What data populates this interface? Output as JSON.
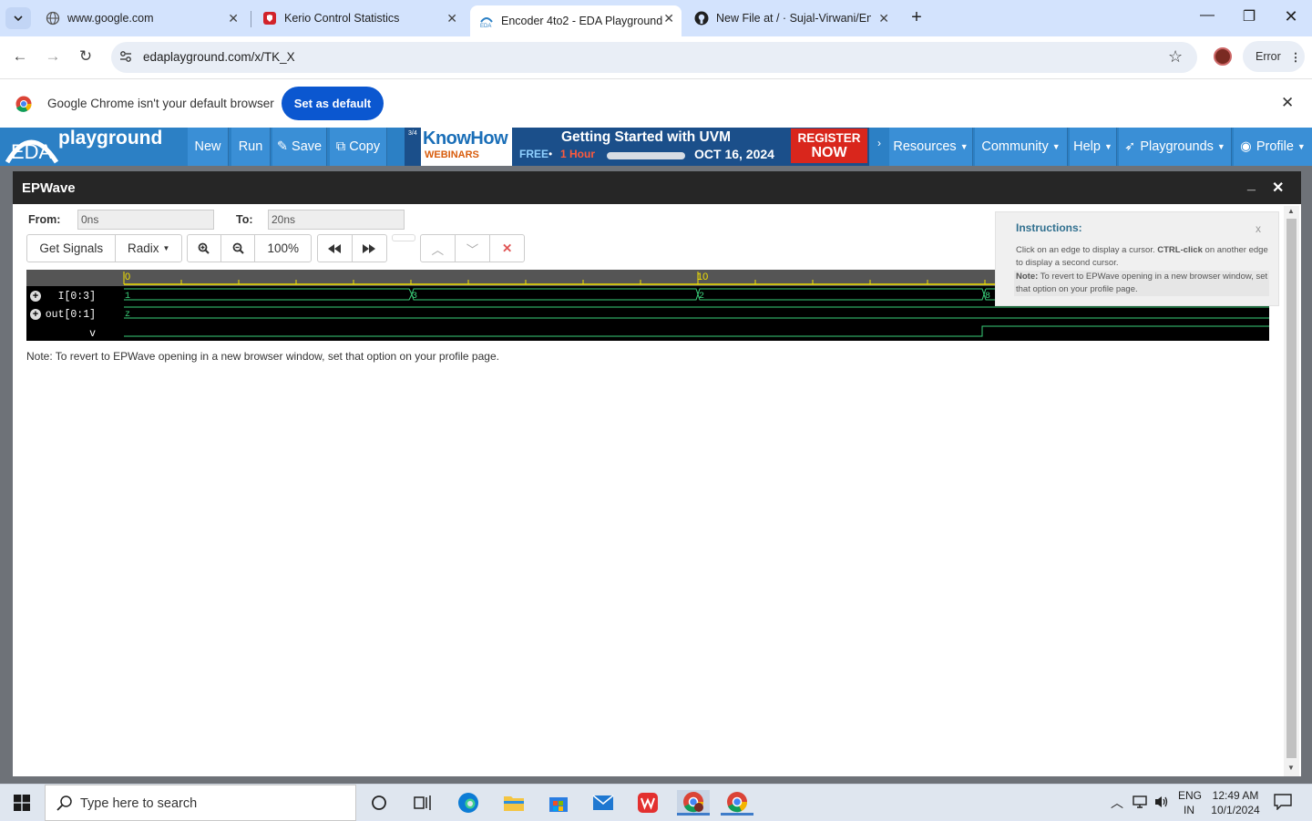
{
  "browser": {
    "tabs": [
      {
        "title": "www.google.com"
      },
      {
        "title": "Kerio Control Statistics"
      },
      {
        "title": "Encoder 4to2 - EDA Playground"
      },
      {
        "title": "New File at / · Sujal-Virwani/Enc"
      }
    ],
    "url": "edaplayground.com/x/TK_X",
    "profile_status": "Error",
    "infobar_message": "Google Chrome isn't your default browser",
    "infobar_button": "Set as default"
  },
  "eda": {
    "logo_text": "EDA",
    "logo_word": "playground",
    "buttons": {
      "new": "New",
      "run": "Run",
      "save": "Save",
      "copy": "Copy"
    },
    "banner": {
      "page_counter": "3/4",
      "brand": "KnowHow",
      "brand_sub": "WEBINARS",
      "headline": "Getting Started with UVM",
      "free": "FREE",
      "duration": "1 Hour",
      "date": "OCT 16, 2024",
      "cta_line1": "REGISTER",
      "cta_line2": "NOW"
    },
    "menus": {
      "resources": "Resources",
      "community": "Community",
      "help": "Help",
      "playgrounds": "Playgrounds",
      "profile": "Profile"
    }
  },
  "epwave": {
    "title": "EPWave",
    "from_label": "From:",
    "from_value": "0ns",
    "to_label": "To:",
    "to_value": "20ns",
    "get_signals": "Get Signals",
    "radix": "Radix",
    "zoom_level": "100%",
    "ruler_labels": [
      "0",
      "10"
    ],
    "signals": [
      {
        "name": "I[0:3]",
        "values": [
          "1",
          "3",
          "2",
          "8"
        ]
      },
      {
        "name": "out[0:1]",
        "values": [
          "z"
        ]
      },
      {
        "name": "v",
        "values": []
      }
    ],
    "note": "Note: To revert to EPWave opening in a new browser window, set that option on your profile page.",
    "instructions": {
      "title": "Instructions:",
      "close": "x",
      "line1a": "Click on an edge to display a cursor. ",
      "line1b": "CTRL-click",
      "line1c": " on another edge to display a second cursor.",
      "note_label": "Note:",
      "note_text": " To revert to EPWave opening in a new browser window, set that option on your profile page."
    }
  },
  "taskbar": {
    "search_placeholder": "Type here to search",
    "lang1": "ENG",
    "lang2": "IN",
    "time": "12:49 AM",
    "date": "10/1/2024"
  },
  "colors": {
    "chrome_tabstrip": "#d3e3fd",
    "eda_blue": "#2c80c5",
    "wave_green": "#3ad07a",
    "ruler_yellow": "#f2e100"
  }
}
